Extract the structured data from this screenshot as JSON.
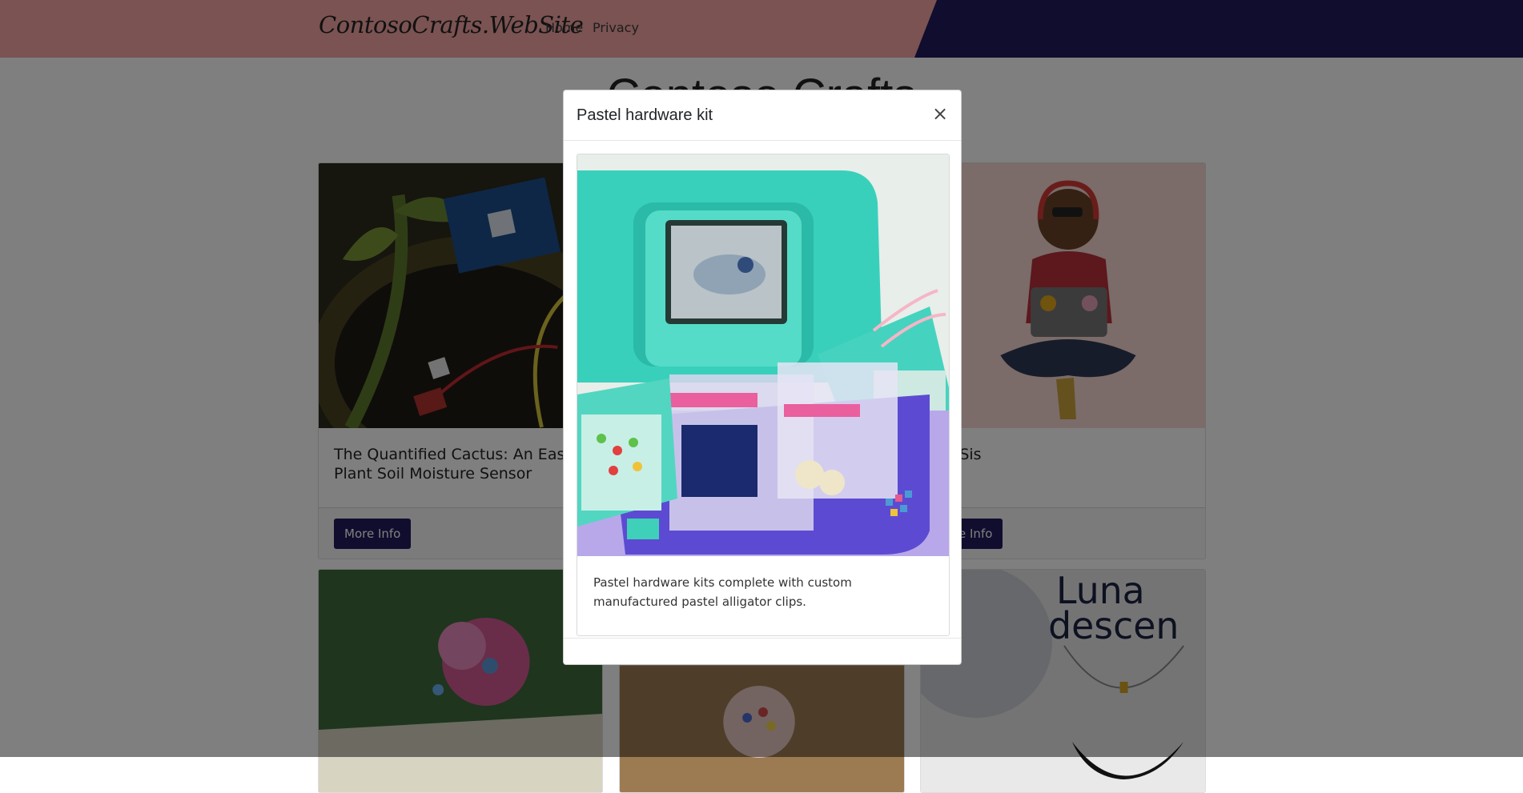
{
  "nav": {
    "brand": "ContosoCrafts.WebSite",
    "links": [
      "Home",
      "Privacy"
    ]
  },
  "page": {
    "heading": "Contoso Crafts"
  },
  "cards": [
    {
      "title": "The Quantified Cactus: An Easy Plant Soil Moisture Sensor",
      "button": "More Info"
    },
    {
      "title": "by Sis",
      "button": "ore Info"
    }
  ],
  "modal": {
    "title": "Pastel hardware kit",
    "close": "×",
    "description": "Pastel hardware kits complete with custom manufactured pastel alligator clips."
  },
  "colors": {
    "navbar_pink": "#f4a7a4",
    "navbar_navy": "#211b5c",
    "button": "#211b5c",
    "backdrop": "rgba(0,0,0,0.5)"
  }
}
